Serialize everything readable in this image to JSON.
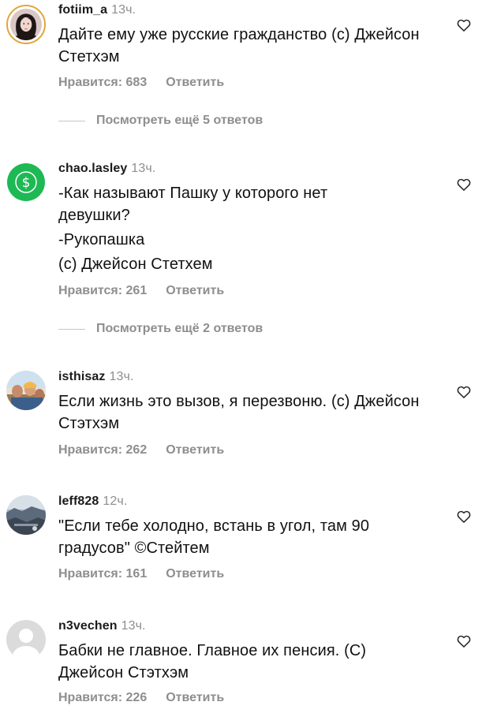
{
  "comments": [
    {
      "username": "fotiim_a",
      "time": "13ч.",
      "lines": [
        "Дайте ему уже русские гражданство (с) Джейсон Стетхэм"
      ],
      "likes_label": "Нравится: 683",
      "reply_label": "Ответить",
      "more_replies": "Посмотреть ещё 5 ответов",
      "avatar": "portrait-photo"
    },
    {
      "username": "chao.lasley",
      "time": "13ч.",
      "lines": [
        "-Как называют Пашку у которого нет девушки?",
        "-Рукопашка",
        "(с) Джейсон Стетхем"
      ],
      "likes_label": "Нравится: 261",
      "reply_label": "Ответить",
      "more_replies": "Посмотреть ещё 2 ответов",
      "avatar": "dollar-sign-icon"
    },
    {
      "username": "isthisaz",
      "time": "13ч.",
      "lines": [
        "Если жизнь это вызов, я перезвоню. (с) Джейсон Стэтхэм"
      ],
      "likes_label": "Нравится: 262",
      "reply_label": "Ответить",
      "avatar": "group-photo"
    },
    {
      "username": "leff828",
      "time": "12ч.",
      "lines": [
        "\"Если тебе холодно, встань в угол, там 90 градусов\" ©Стейтем"
      ],
      "likes_label": "Нравится: 161",
      "reply_label": "Ответить",
      "avatar": "landscape-photo"
    },
    {
      "username": "n3vechen",
      "time": "13ч.",
      "lines": [
        "Бабки не главное. Главное их пенсия. (С) Джейсон Стэтхэм"
      ],
      "likes_label": "Нравится: 226",
      "reply_label": "Ответить",
      "avatar": "default-user-icon"
    }
  ],
  "colors": {
    "text": "#111111",
    "muted": "#8e8e8e",
    "dollar_green": "#1db954",
    "story_ring": "#e3a53a"
  }
}
